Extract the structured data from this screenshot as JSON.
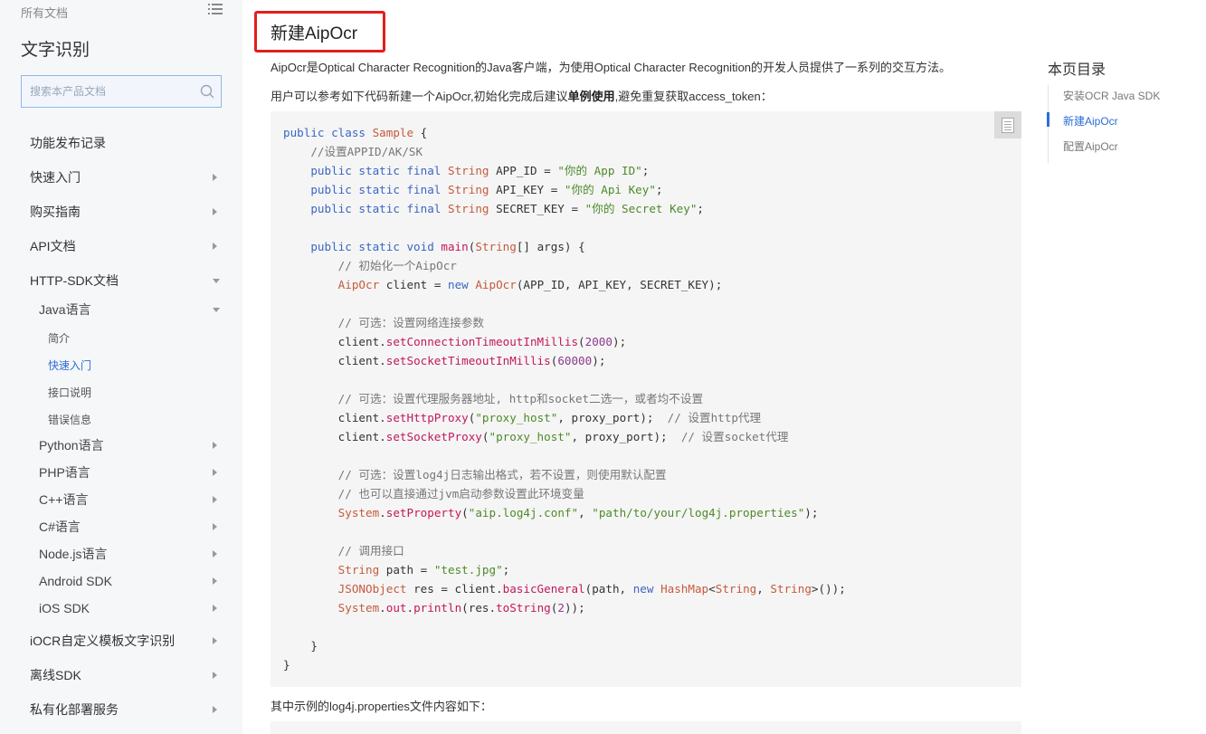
{
  "sidebar": {
    "all_docs": "所有文档",
    "product_title": "文字识别",
    "search_placeholder": "搜索本产品文档",
    "items": [
      {
        "label": "功能发布记录",
        "level": 0,
        "arrow": "none"
      },
      {
        "label": "快速入门",
        "level": 0,
        "arrow": "right"
      },
      {
        "label": "购买指南",
        "level": 0,
        "arrow": "right"
      },
      {
        "label": "API文档",
        "level": 0,
        "arrow": "right"
      },
      {
        "label": "HTTP-SDK文档",
        "level": 0,
        "arrow": "down"
      },
      {
        "label": "Java语言",
        "level": 1,
        "arrow": "down"
      },
      {
        "label": "简介",
        "level": 2,
        "arrow": "none"
      },
      {
        "label": "快速入门",
        "level": 2,
        "arrow": "none",
        "active": true
      },
      {
        "label": "接口说明",
        "level": 2,
        "arrow": "none"
      },
      {
        "label": "错误信息",
        "level": 2,
        "arrow": "none"
      },
      {
        "label": "Python语言",
        "level": 1,
        "arrow": "right"
      },
      {
        "label": "PHP语言",
        "level": 1,
        "arrow": "right"
      },
      {
        "label": "C++语言",
        "level": 1,
        "arrow": "right"
      },
      {
        "label": "C#语言",
        "level": 1,
        "arrow": "right"
      },
      {
        "label": "Node.js语言",
        "level": 1,
        "arrow": "right"
      },
      {
        "label": "Android SDK",
        "level": 1,
        "arrow": "right"
      },
      {
        "label": "iOS SDK",
        "level": 1,
        "arrow": "right"
      },
      {
        "label": "iOCR自定义模板文字识别",
        "level": 0,
        "arrow": "right"
      },
      {
        "label": "离线SDK",
        "level": 0,
        "arrow": "right"
      },
      {
        "label": "私有化部署服务",
        "level": 0,
        "arrow": "right"
      }
    ]
  },
  "content": {
    "title": "新建AipOcr",
    "intro": "AipOcr是Optical Character Recognition的Java客户端，为使用Optical Character Recognition的开发人员提供了一系列的交互方法。",
    "usage_before": "用户可以参考如下代码新建一个AipOcr,初始化完成后建议",
    "usage_bold": "单例使用",
    "usage_after": ",避免重复获取access_token：",
    "bottom_note": "其中示例的log4j.properties文件内容如下：",
    "code_lines": [
      [
        [
          "kw",
          "public class "
        ],
        [
          "ty",
          "Sample"
        ],
        [
          "plain",
          " {"
        ]
      ],
      [
        [
          "cm",
          "    //设置APPID/AK/SK"
        ]
      ],
      [
        [
          "kw",
          "    public static final "
        ],
        [
          "ty",
          "String"
        ],
        [
          "plain",
          " APP_ID = "
        ],
        [
          "st",
          "\"你的 App ID\""
        ],
        [
          "plain",
          ";"
        ]
      ],
      [
        [
          "kw",
          "    public static final "
        ],
        [
          "ty",
          "String"
        ],
        [
          "plain",
          " API_KEY = "
        ],
        [
          "st",
          "\"你的 Api Key\""
        ],
        [
          "plain",
          ";"
        ]
      ],
      [
        [
          "kw",
          "    public static final "
        ],
        [
          "ty",
          "String"
        ],
        [
          "plain",
          " SECRET_KEY = "
        ],
        [
          "st",
          "\"你的 Secret Key\""
        ],
        [
          "plain",
          ";"
        ]
      ],
      [
        [
          "plain",
          ""
        ]
      ],
      [
        [
          "kw",
          "    public static void "
        ],
        [
          "fn",
          "main"
        ],
        [
          "plain",
          "("
        ],
        [
          "ty",
          "String"
        ],
        [
          "plain",
          "[] args) {"
        ]
      ],
      [
        [
          "cm",
          "        // 初始化一个AipOcr"
        ]
      ],
      [
        [
          "ty",
          "        AipOcr"
        ],
        [
          "plain",
          " client = "
        ],
        [
          "kw",
          "new "
        ],
        [
          "ty",
          "AipOcr"
        ],
        [
          "plain",
          "(APP_ID, API_KEY, SECRET_KEY);"
        ]
      ],
      [
        [
          "plain",
          ""
        ]
      ],
      [
        [
          "cm",
          "        // 可选：设置网络连接参数"
        ]
      ],
      [
        [
          "plain",
          "        client."
        ],
        [
          "fn",
          "setConnectionTimeoutInMillis"
        ],
        [
          "plain",
          "("
        ],
        [
          "nu",
          "2000"
        ],
        [
          "plain",
          ");"
        ]
      ],
      [
        [
          "plain",
          "        client."
        ],
        [
          "fn",
          "setSocketTimeoutInMillis"
        ],
        [
          "plain",
          "("
        ],
        [
          "nu",
          "60000"
        ],
        [
          "plain",
          ");"
        ]
      ],
      [
        [
          "plain",
          ""
        ]
      ],
      [
        [
          "cm",
          "        // 可选：设置代理服务器地址, http和socket二选一，或者均不设置"
        ]
      ],
      [
        [
          "plain",
          "        client."
        ],
        [
          "fn",
          "setHttpProxy"
        ],
        [
          "plain",
          "("
        ],
        [
          "st",
          "\"proxy_host\""
        ],
        [
          "plain",
          ", proxy_port);  "
        ],
        [
          "cm",
          "// 设置http代理"
        ]
      ],
      [
        [
          "plain",
          "        client."
        ],
        [
          "fn",
          "setSocketProxy"
        ],
        [
          "plain",
          "("
        ],
        [
          "st",
          "\"proxy_host\""
        ],
        [
          "plain",
          ", proxy_port);  "
        ],
        [
          "cm",
          "// 设置socket代理"
        ]
      ],
      [
        [
          "plain",
          ""
        ]
      ],
      [
        [
          "cm",
          "        // 可选：设置log4j日志输出格式，若不设置，则使用默认配置"
        ]
      ],
      [
        [
          "cm",
          "        // 也可以直接通过jvm启动参数设置此环境变量"
        ]
      ],
      [
        [
          "ty",
          "        System"
        ],
        [
          "plain",
          "."
        ],
        [
          "fn",
          "setProperty"
        ],
        [
          "plain",
          "("
        ],
        [
          "st",
          "\"aip.log4j.conf\""
        ],
        [
          "plain",
          ", "
        ],
        [
          "st",
          "\"path/to/your/log4j.properties\""
        ],
        [
          "plain",
          ");"
        ]
      ],
      [
        [
          "plain",
          ""
        ]
      ],
      [
        [
          "cm",
          "        // 调用接口"
        ]
      ],
      [
        [
          "ty",
          "        String"
        ],
        [
          "plain",
          " path = "
        ],
        [
          "st",
          "\"test.jpg\""
        ],
        [
          "plain",
          ";"
        ]
      ],
      [
        [
          "ty",
          "        JSONObject"
        ],
        [
          "plain",
          " res = client."
        ],
        [
          "fn",
          "basicGeneral"
        ],
        [
          "plain",
          "(path, "
        ],
        [
          "kw",
          "new "
        ],
        [
          "ty",
          "HashMap"
        ],
        [
          "plain",
          "<"
        ],
        [
          "ty",
          "String"
        ],
        [
          "plain",
          ", "
        ],
        [
          "ty",
          "String"
        ],
        [
          "plain",
          ">());"
        ]
      ],
      [
        [
          "ty",
          "        System"
        ],
        [
          "plain",
          "."
        ],
        [
          "fn",
          "out"
        ],
        [
          "plain",
          "."
        ],
        [
          "fn",
          "println"
        ],
        [
          "plain",
          "(res."
        ],
        [
          "fn",
          "toString"
        ],
        [
          "plain",
          "("
        ],
        [
          "nu",
          "2"
        ],
        [
          "plain",
          "));"
        ]
      ],
      [
        [
          "plain",
          ""
        ]
      ],
      [
        [
          "plain",
          "    }"
        ]
      ],
      [
        [
          "plain",
          "}"
        ]
      ]
    ]
  },
  "toc": {
    "title": "本页目录",
    "items": [
      {
        "label": "安装OCR Java SDK",
        "active": false
      },
      {
        "label": "新建AipOcr",
        "active": true
      },
      {
        "label": "配置AipOcr",
        "active": false
      }
    ]
  },
  "colors": {
    "accent": "#2c6dd5",
    "highlight_border": "#e0201b"
  }
}
